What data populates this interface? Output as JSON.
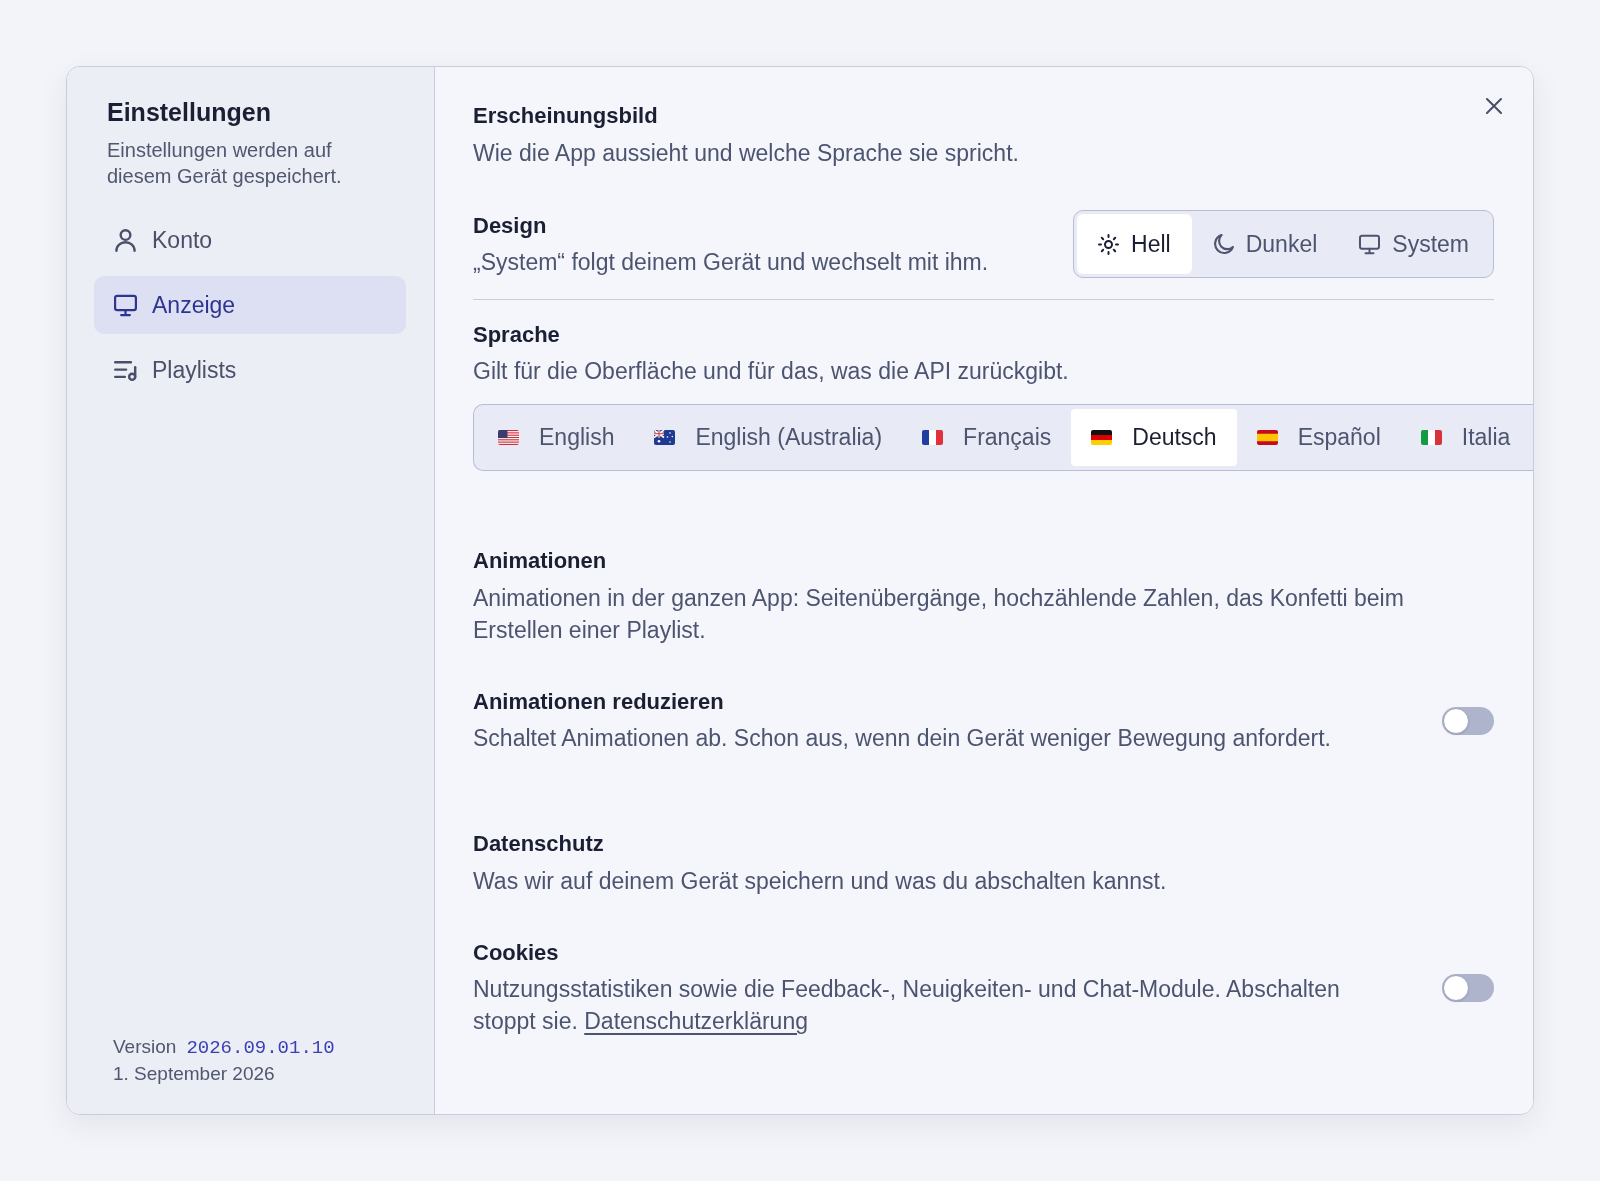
{
  "sidebar": {
    "title": "Einstellungen",
    "subtitle": "Einstellungen werden auf diesem Gerät gespeichert.",
    "items": [
      {
        "label": "Konto",
        "kind": "account",
        "selected": false
      },
      {
        "label": "Anzeige",
        "kind": "display",
        "selected": true
      },
      {
        "label": "Playlists",
        "kind": "playlists",
        "selected": false
      }
    ],
    "version_label": "Version",
    "version": "2026.09.01.10",
    "date": "1. September 2026"
  },
  "sections": [
    {
      "title": "Erscheinungsbild",
      "description": "Wie die App aussieht und welche Sprache sie spricht.",
      "rows": [
        {
          "kind": "segmented",
          "label": "Design",
          "description": "„System“ folgt deinem Gerät und wechselt mit ihm.",
          "options": [
            {
              "label": "Hell",
              "kind": "light",
              "selected": true
            },
            {
              "label": "Dunkel",
              "kind": "dark",
              "selected": false
            },
            {
              "label": "System",
              "kind": "system",
              "selected": false
            }
          ]
        },
        {
          "kind": "tabs",
          "label": "Sprache",
          "description": "Gilt für die Oberfläche und für das, was die API zurückgibt.",
          "options": [
            {
              "label": "English",
              "kind": "us",
              "selected": false
            },
            {
              "label": "English (Australia)",
              "kind": "au",
              "selected": false
            },
            {
              "label": "Français",
              "kind": "fr",
              "selected": false
            },
            {
              "label": "Deutsch",
              "kind": "de",
              "selected": true
            },
            {
              "label": "Español",
              "kind": "es",
              "selected": false
            },
            {
              "label": "Italia",
              "kind": "it",
              "selected": false
            }
          ]
        }
      ]
    },
    {
      "title": "Animationen",
      "description": "Animationen in der ganzen App: Seitenübergänge, hochzählende Zahlen, das Konfetti beim Erstellen einer Playlist.",
      "rows": [
        {
          "kind": "toggle",
          "label": "Animationen reduzieren",
          "description": "Schaltet Animationen ab. Schon aus, wenn dein Gerät weniger Bewegung anfordert.",
          "on": false
        }
      ]
    },
    {
      "title": "Datenschutz",
      "description": "Was wir auf deinem Gerät speichern und was du abschalten kannst.",
      "rows": [
        {
          "kind": "toggle",
          "label": "Cookies",
          "description": "Nutzungsstatistiken sowie die Feedback-, Neuigkeiten- und Chat-Module. Abschalten stoppt sie.",
          "link": "Datenschutzerklärung",
          "on": false
        }
      ]
    }
  ]
}
